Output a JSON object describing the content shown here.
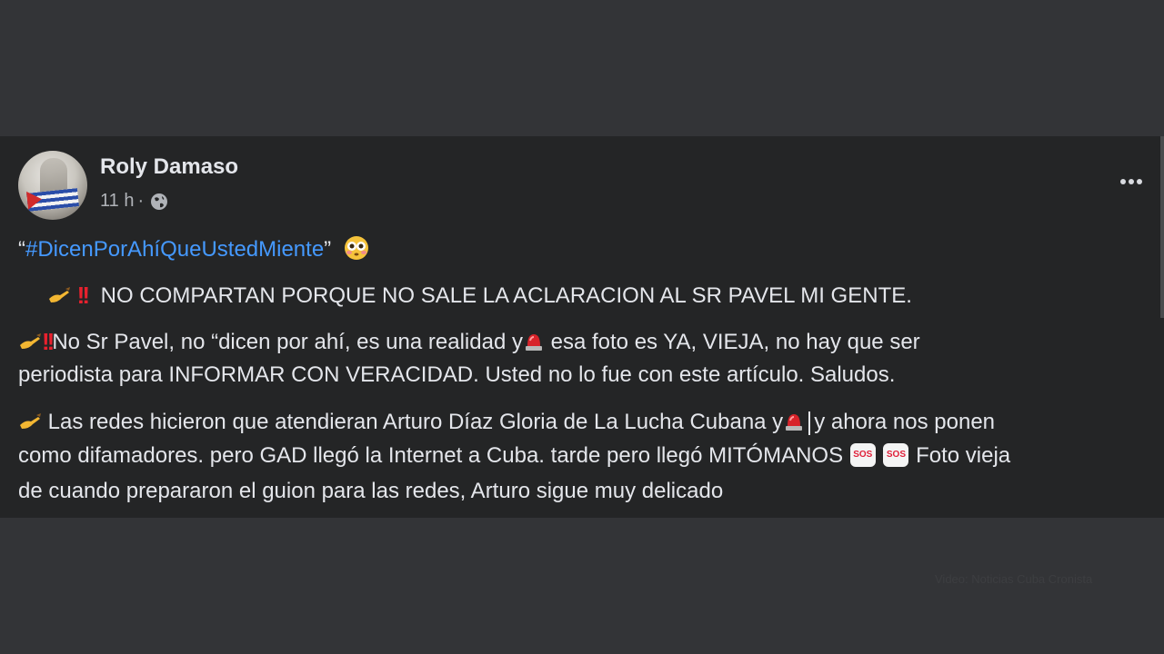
{
  "post": {
    "author": "Roly Damaso",
    "time": "11 h",
    "separator": "·",
    "audience_icon": "globe-icon",
    "more_icon": "more-options-icon",
    "quote_open": "“",
    "hashtag": "#DicenPorAhíQueUstedMiente",
    "quote_close": "”",
    "paragraph1": "NO COMPARTAN PORQUE NO SALE LA ACLARACION AL SR  PAVEL MI GENTE.",
    "paragraph2_a": "No Sr Pavel, no “dicen por ahí, es una  realidad y",
    "paragraph2_b": " esa foto es YA, VIEJA, no hay que ser",
    "paragraph2_line2": "periodista para INFORMAR CON VERACIDAD. Usted no lo fue con este artículo. Saludos.",
    "paragraph3_a": " Las redes hicieron que atendieran Arturo Díaz Gloria de La Lucha Cubana y",
    "paragraph3_b": "y ahora nos ponen",
    "paragraph3_line2_a": "como difamadores. pero GAD llegó la Internet a Cuba. tarde pero llegó MITÓMANOS ",
    "paragraph3_line2_b": " Foto vieja",
    "paragraph3_line3": "de cuando prepararon el guion para las redes, Arturo sigue muy delicado",
    "sos_label": "SOS"
  },
  "watermark": "Video: Noticias Cuba Cronista",
  "colors": {
    "page_bg": "#333437",
    "post_bg": "#242526",
    "text": "#e4e6eb",
    "muted": "#b0b3b8",
    "link": "#4599ff",
    "alert": "#e8212e"
  }
}
